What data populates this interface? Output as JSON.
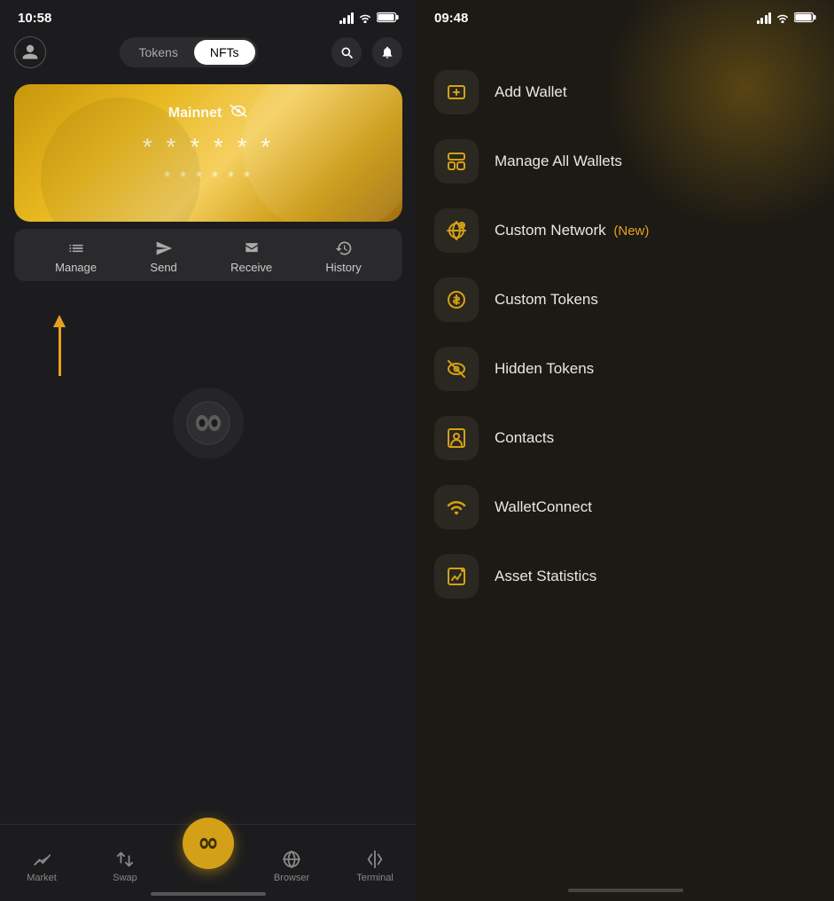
{
  "left_phone": {
    "status_bar": {
      "time": "10:58"
    },
    "nav": {
      "tab_tokens": "Tokens",
      "tab_nfts": "NFTs",
      "active_tab": "nfts"
    },
    "card": {
      "network": "Mainnet",
      "stars_main": "* * * * * *",
      "stars_sub": "* * * * * *"
    },
    "actions": {
      "manage": "Manage",
      "send": "Send",
      "receive": "Receive",
      "history": "History"
    },
    "bottom_nav": {
      "market": "Market",
      "swap": "Swap",
      "browser": "Browser",
      "terminal": "Terminal"
    }
  },
  "right_phone": {
    "status_bar": {
      "time": "09:48"
    },
    "menu_items": [
      {
        "id": "add-wallet",
        "label": "Add Wallet",
        "new": false,
        "icon": "➕"
      },
      {
        "id": "manage-wallets",
        "label": "Manage All Wallets",
        "new": false,
        "icon": "🗂"
      },
      {
        "id": "custom-network",
        "label": "Custom Network",
        "new": true,
        "new_label": "(New)",
        "icon": "🔗"
      },
      {
        "id": "custom-tokens",
        "label": "Custom Tokens",
        "new": false,
        "icon": "🪙"
      },
      {
        "id": "hidden-tokens",
        "label": "Hidden Tokens",
        "new": false,
        "icon": "👁"
      },
      {
        "id": "contacts",
        "label": "Contacts",
        "new": false,
        "icon": "👤"
      },
      {
        "id": "wallet-connect",
        "label": "WalletConnect",
        "new": false,
        "icon": "〰"
      },
      {
        "id": "asset-statistics",
        "label": "Asset Statistics",
        "new": false,
        "icon": "📊"
      }
    ]
  },
  "colors": {
    "gold": "#d4a017",
    "gold_arrow": "#e8a020",
    "bg_dark": "#1c1c1e",
    "bg_warm": "#1c1a14"
  }
}
